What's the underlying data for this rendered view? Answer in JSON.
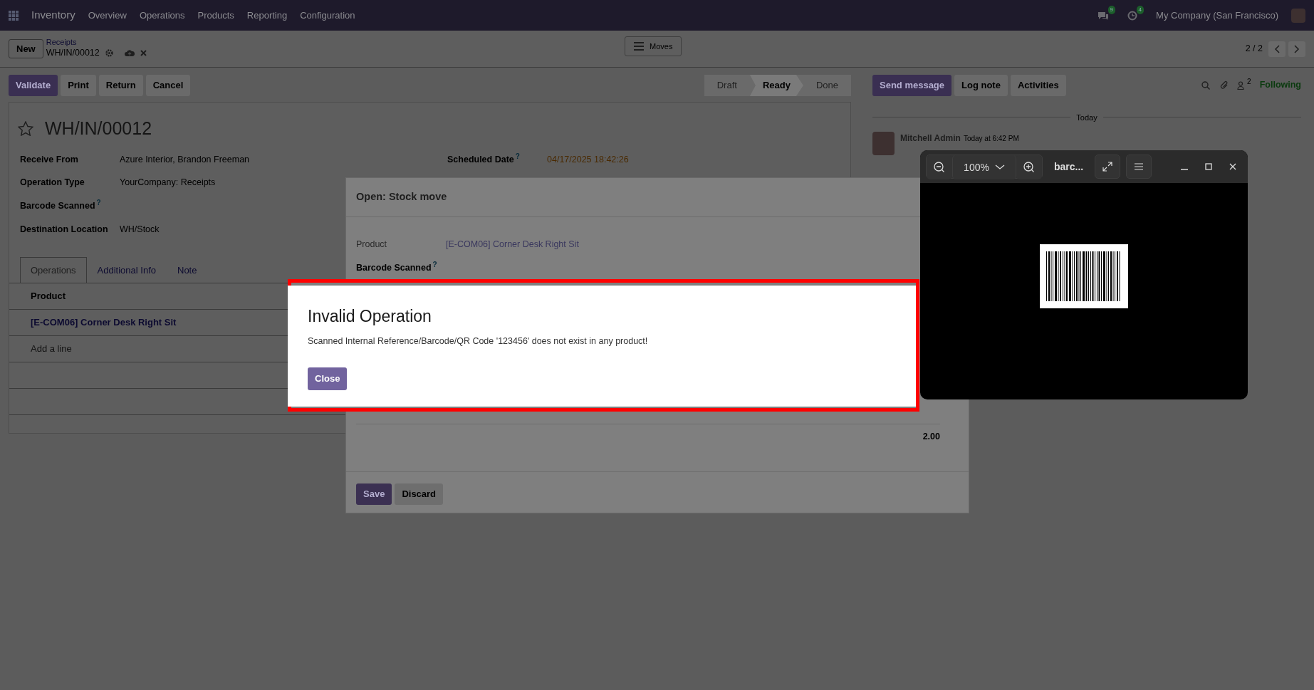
{
  "navbar": {
    "app": "Inventory",
    "menu": [
      "Overview",
      "Operations",
      "Products",
      "Reporting",
      "Configuration"
    ],
    "messages_count": "9",
    "activities_count": "4",
    "company": "My Company (San Francisco)"
  },
  "control_panel": {
    "new_button": "New",
    "breadcrumb": "Receipts",
    "record": "WH/IN/00012",
    "view_button": "Moves",
    "pager": "2 / 2"
  },
  "actions": [
    {
      "label": "Validate",
      "primary": true
    },
    {
      "label": "Print",
      "primary": false
    },
    {
      "label": "Return",
      "primary": false
    },
    {
      "label": "Cancel",
      "primary": false
    }
  ],
  "statusbar": [
    {
      "label": "Draft",
      "selected": false
    },
    {
      "label": "Ready",
      "selected": true
    },
    {
      "label": "Done",
      "selected": false
    }
  ],
  "form": {
    "title": "WH/IN/00012",
    "starred": false,
    "fields_left": [
      {
        "label": "Receive From",
        "value": "Azure Interior, Brandon Freeman"
      },
      {
        "label": "Operation Type",
        "value": "YourCompany: Receipts"
      },
      {
        "label": "Barcode Scanned",
        "help": "?"
      },
      {
        "label": "Destination Location",
        "value": "WH/Stock"
      }
    ],
    "fields_right": [
      {
        "label": "Scheduled Date",
        "help": "?",
        "value": "04/17/2025 18:42:26"
      }
    ],
    "tabs": [
      {
        "label": "Operations",
        "selected": true
      },
      {
        "label": "Additional Info",
        "selected": false
      },
      {
        "label": "Note",
        "selected": false
      }
    ],
    "table": {
      "columns": [
        "Product"
      ],
      "rows": [
        "[E-COM06] Corner Desk Right Sit"
      ],
      "add_line": "Add a line"
    }
  },
  "chatter": {
    "buttons": [
      {
        "label": "Send message",
        "primary": true
      },
      {
        "label": "Log note",
        "primary": false
      },
      {
        "label": "Activities",
        "primary": false
      }
    ],
    "followers_count": "2",
    "follow_label": "Following",
    "date_separator": "Today",
    "messages": [
      {
        "author": "Mitchell Admin",
        "time": "Today at 6:42 PM"
      }
    ]
  },
  "stock_move_dialog": {
    "title": "Open: Stock move",
    "fields": [
      {
        "label": "Product",
        "value": "[E-COM06] Corner Desk Right Sit"
      },
      {
        "label": "Barcode Scanned",
        "help": "?"
      }
    ],
    "total": "2.00",
    "buttons": [
      {
        "label": "Save",
        "primary": true
      },
      {
        "label": "Discard",
        "primary": false
      }
    ]
  },
  "error_dialog": {
    "title": "Invalid Operation",
    "message": "Scanned Internal Reference/Barcode/QR Code '123456' does not exist in any product!",
    "button": "Close"
  },
  "image_viewer": {
    "zoom": "100%",
    "title": "barc..."
  }
}
